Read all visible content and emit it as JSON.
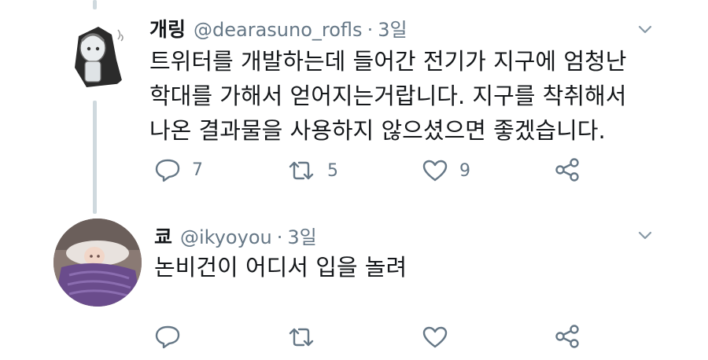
{
  "tweets": [
    {
      "name": "개링",
      "handle": "@dearasuno_rofls",
      "separator": "·",
      "time": "3일",
      "text": "트위터를 개발하는데 들어간 전기가 지구에 엄청난\n학대를 가해서 얻어지는거랍니다. 지구를 착취해서\n나온 결과물을 사용하지 않으셨으면 좋겠습니다.",
      "actions": {
        "reply_count": "7",
        "retweet_count": "5",
        "like_count": "9"
      }
    },
    {
      "name": "쿄",
      "handle": "@ikyoyou",
      "separator": "·",
      "time": "3일",
      "text": "논비건이 어디서 입을 놀려",
      "actions": {
        "reply_count": "",
        "retweet_count": "",
        "like_count": ""
      }
    }
  ],
  "icons": {
    "reply": "reply-icon",
    "retweet": "retweet-icon",
    "like": "heart-icon",
    "share": "share-icon",
    "more": "chevron-down-icon"
  },
  "colors": {
    "text": "#14171a",
    "secondary": "#657786",
    "thread_line": "#cfd9de"
  }
}
